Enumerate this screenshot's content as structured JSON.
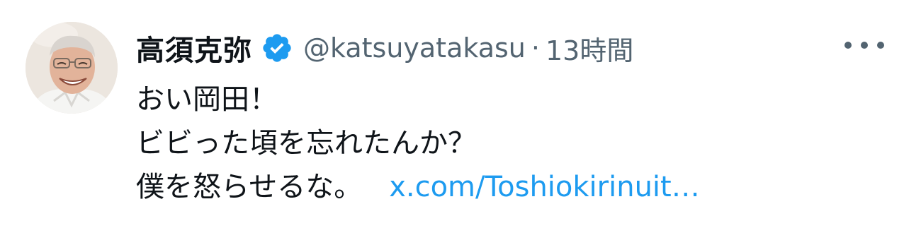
{
  "tweet": {
    "author": {
      "display_name": "高須克弥",
      "verified": true,
      "handle": "@katsuyatakasu"
    },
    "separator": "·",
    "timestamp": "13時間",
    "more_icon": "more-horizontal-icon",
    "text_lines": [
      "おい岡田！",
      "ビビった頃を忘れたんか？",
      "僕を怒らせるな。"
    ],
    "link_text": "x.com/Toshiokirinuit…"
  },
  "colors": {
    "verified_badge": "#1d9bf0",
    "link": "#1d9bf0",
    "secondary_text": "#536471",
    "primary_text": "#0f1419"
  }
}
